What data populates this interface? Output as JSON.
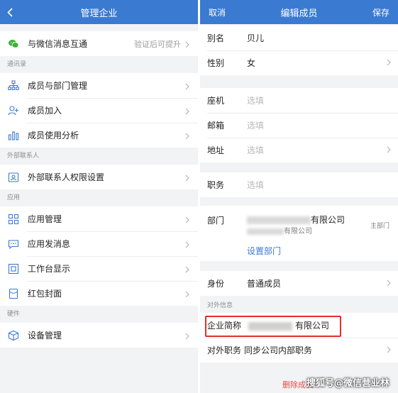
{
  "left": {
    "title": "管理企业",
    "wechat": {
      "label": "与微信消息互通",
      "hint": "验证后可提升"
    },
    "sections": [
      {
        "title": "通讯录",
        "items": [
          {
            "label": "成员与部门管理",
            "icon": "org-chart-icon"
          },
          {
            "label": "成员加入",
            "icon": "add-user-icon"
          },
          {
            "label": "成员使用分析",
            "icon": "bar-chart-icon"
          }
        ]
      },
      {
        "title": "外部联系人",
        "items": [
          {
            "label": "外部联系人权限设置",
            "icon": "contact-card-icon"
          }
        ]
      },
      {
        "title": "应用",
        "items": [
          {
            "label": "应用管理",
            "icon": "grid-icon"
          },
          {
            "label": "应用发消息",
            "icon": "message-icon"
          },
          {
            "label": "工作台显示",
            "icon": "workbench-icon"
          },
          {
            "label": "红包封面",
            "icon": "red-packet-icon"
          }
        ]
      },
      {
        "title": "硬件",
        "items": [
          {
            "label": "设备管理",
            "icon": "device-box-icon"
          }
        ]
      }
    ]
  },
  "right": {
    "cancel": "取消",
    "title": "编辑成员",
    "save": "保存",
    "alias": {
      "key": "别名",
      "value": "贝儿"
    },
    "gender": {
      "key": "性别",
      "value": "女"
    },
    "phone": {
      "key": "座机",
      "placeholder": "选填"
    },
    "email": {
      "key": "邮箱",
      "placeholder": "选填"
    },
    "address": {
      "key": "地址",
      "placeholder": "选填"
    },
    "position": {
      "key": "职务",
      "placeholder": "选填"
    },
    "department": {
      "key": "部门",
      "line1_suffix": "有限公司",
      "line2_suffix": "有限公司",
      "tag": "主部门",
      "set_label": "设置部门"
    },
    "identity": {
      "key": "身份",
      "value": "普通成员"
    },
    "external_title": "对外信息",
    "company_short": {
      "key": "企业简称",
      "suffix": "有限公司"
    },
    "external_position": {
      "key": "对外职务",
      "value": "同步公司内部职务"
    },
    "delete_label": "删除成员"
  },
  "watermark": "搜狐号@微信营业林",
  "colors": {
    "accent": "#3b7ad1",
    "highlight": "#e0302c"
  }
}
